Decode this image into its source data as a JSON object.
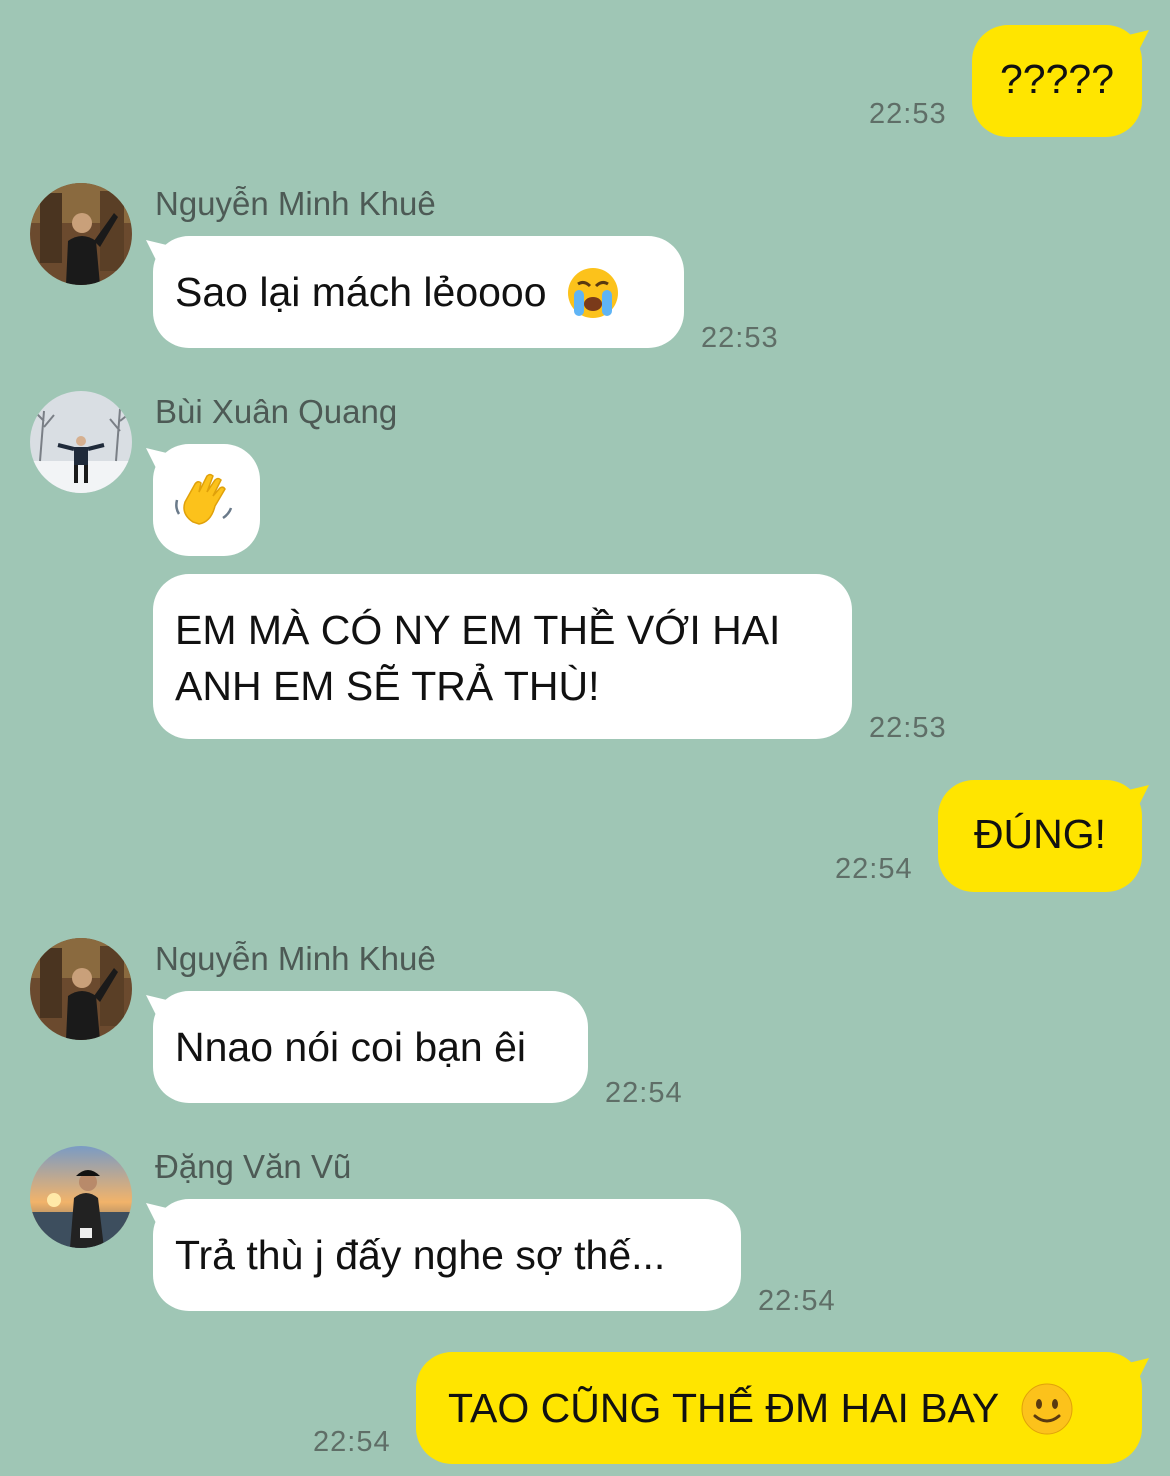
{
  "messages": [
    {
      "sender": "me",
      "text": "?????",
      "time": "22:53"
    },
    {
      "sender": "Nguyễn Minh Khuê",
      "text": "Sao lại mách lẻoooo",
      "emoji": "loudly-crying-face-icon",
      "time": "22:53"
    },
    {
      "sender": "Bùi Xuân Quang",
      "emoji": "waving-hand-icon"
    },
    {
      "sender": "Bùi Xuân Quang",
      "text_lines": [
        "EM MÀ CÓ NY EM THỀ VỚI HAI",
        "ANH EM SẼ TRẢ THÙ!"
      ],
      "time": "22:53"
    },
    {
      "sender": "me",
      "text": "ĐÚNG!",
      "time": "22:54"
    },
    {
      "sender": "Nguyễn Minh Khuê",
      "text": "Nnao nói coi bạn êi",
      "time": "22:54"
    },
    {
      "sender": "Đặng Văn Vũ",
      "text": "Trả thù j đấy nghe sợ thế...",
      "time": "22:54"
    },
    {
      "sender": "me",
      "text": "TAO CŨNG THẾ ĐM HAI BAY",
      "emoji": "slightly-smiling-face-icon",
      "time": "22:54"
    }
  ],
  "colors": {
    "background": "#9fc6b5",
    "outgoing_bubble": "#ffe500",
    "incoming_bubble": "#ffffff"
  }
}
